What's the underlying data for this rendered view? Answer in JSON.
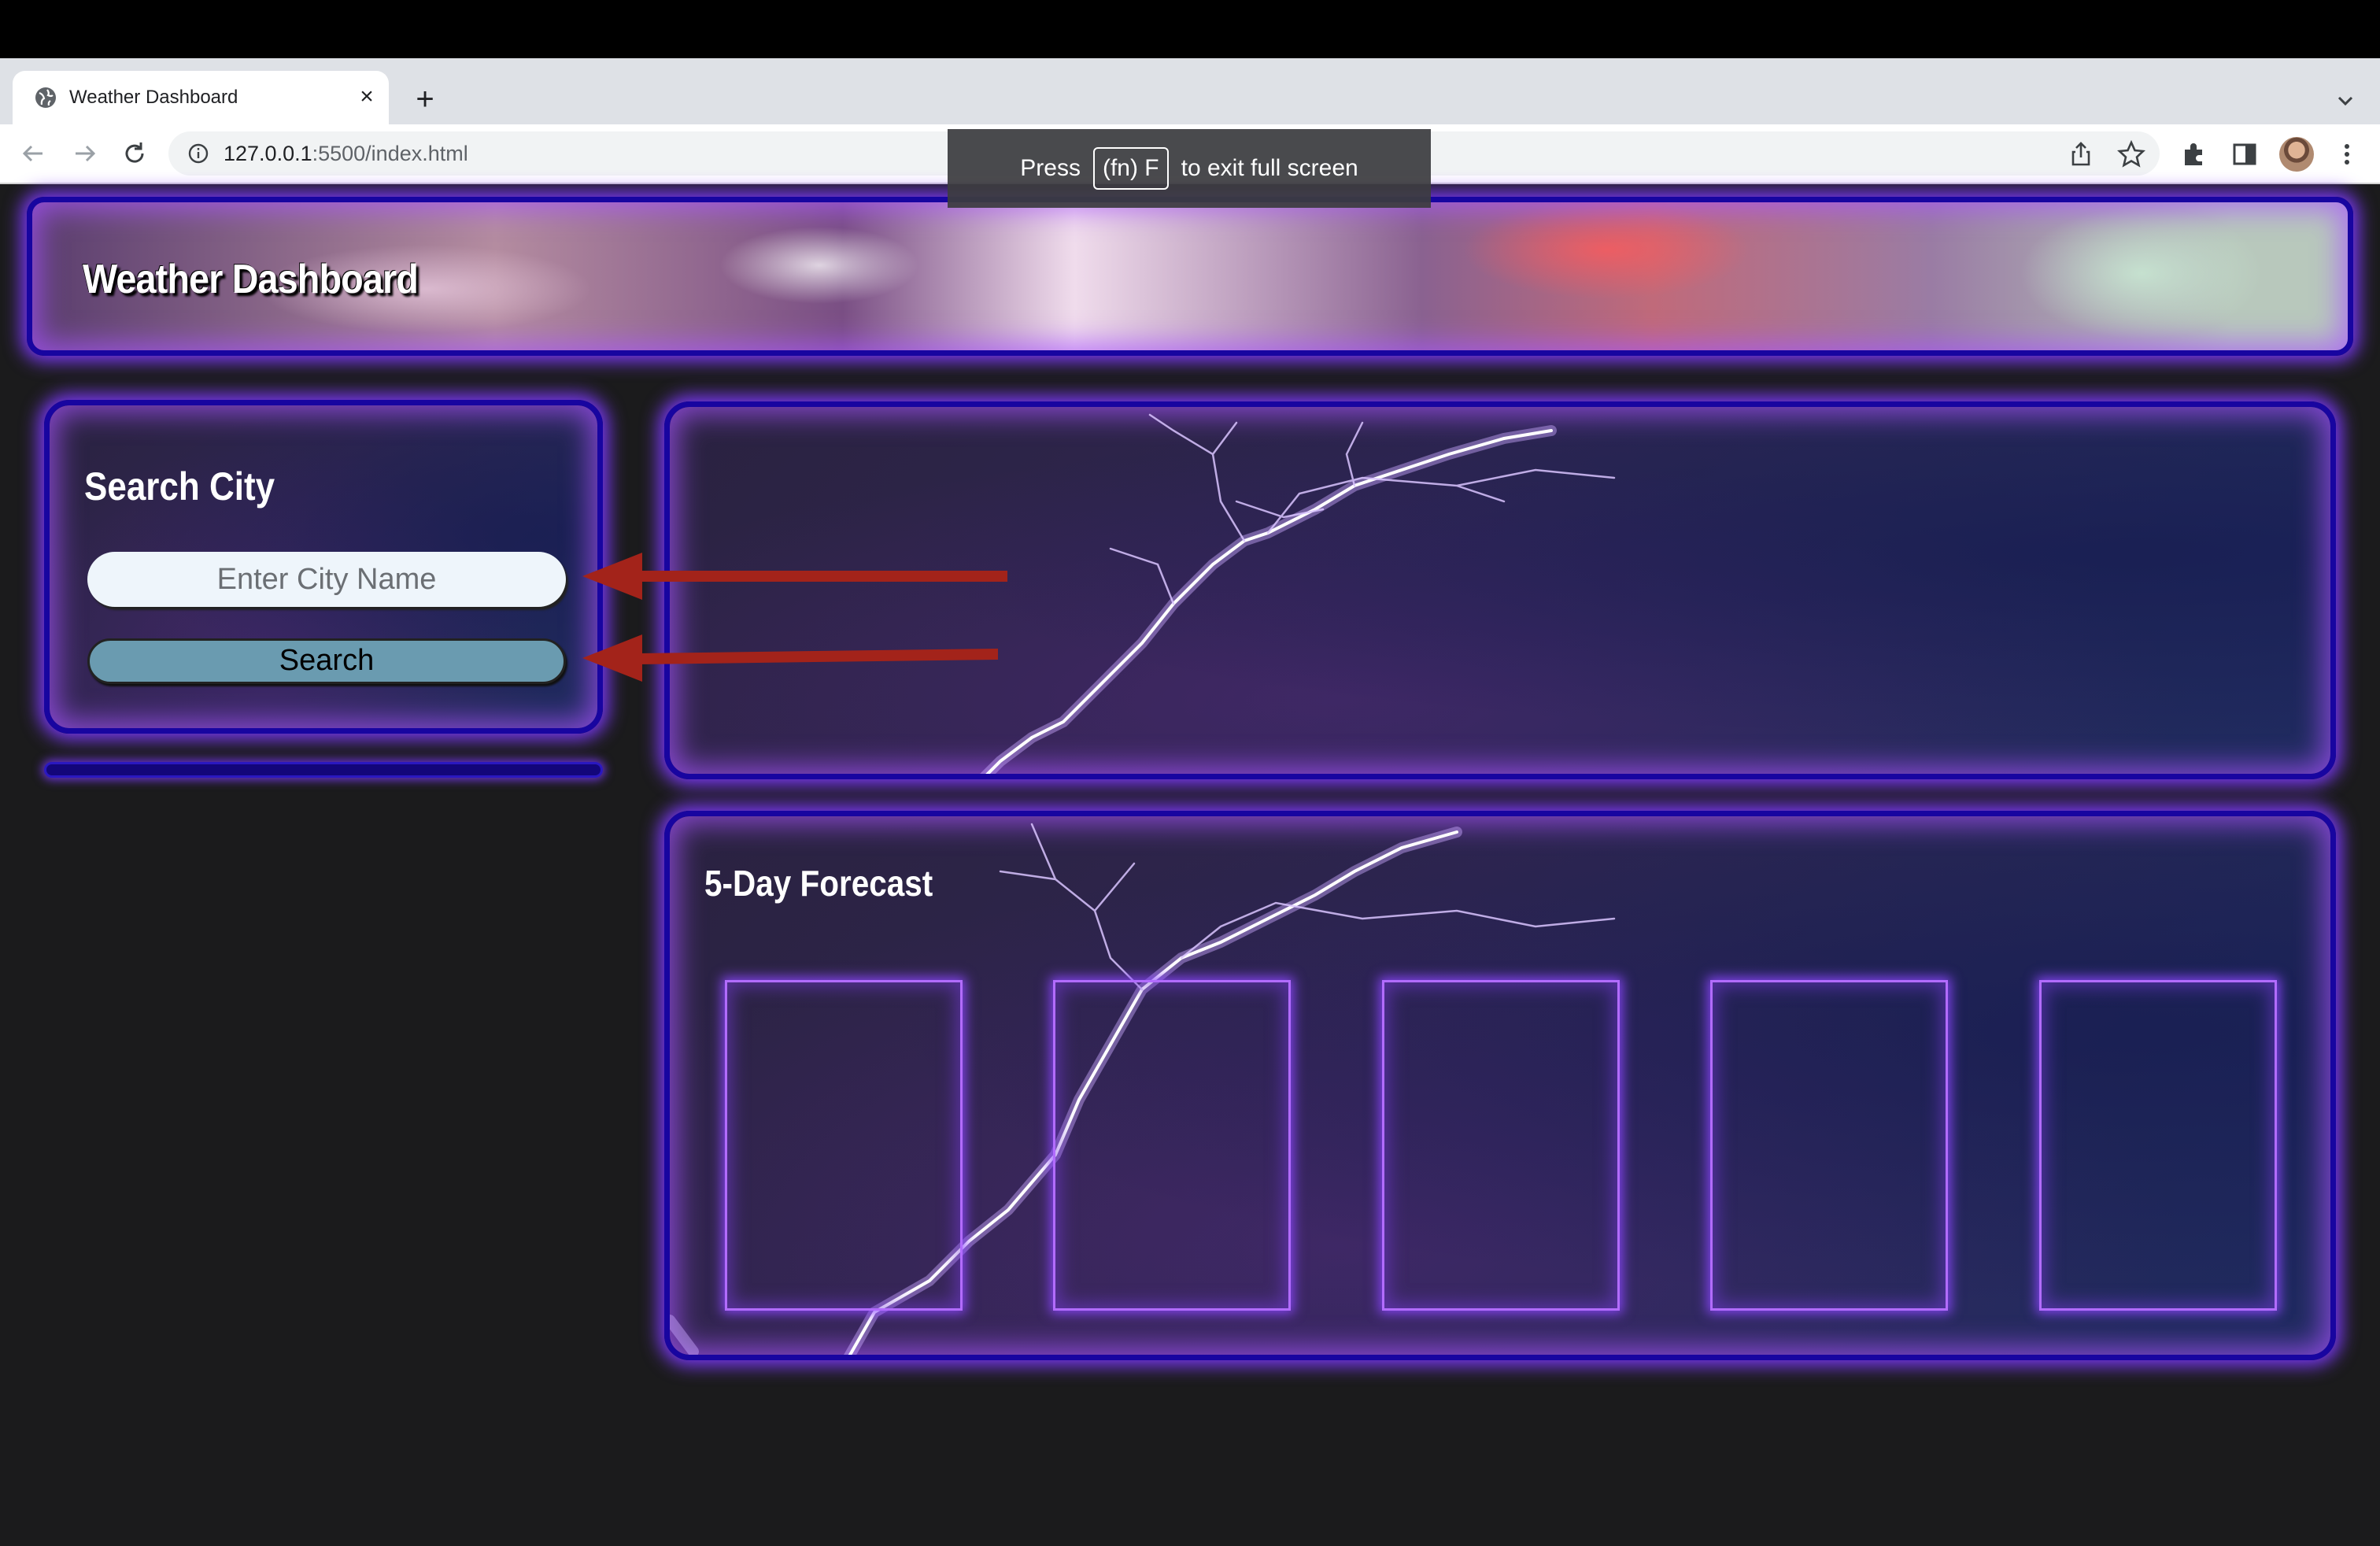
{
  "browser": {
    "tab_title": "Weather Dashboard",
    "url_host": "127.0.0.1",
    "url_rest": ":5500/index.html",
    "fullscreen_toast": {
      "prefix": "Press",
      "key": "(fn) F",
      "suffix": "to exit full screen"
    }
  },
  "page": {
    "header_title": "Weather Dashboard",
    "search": {
      "title": "Search City",
      "input_placeholder": "Enter City Name",
      "input_value": "",
      "button_label": "Search"
    },
    "forecast": {
      "title": "5-Day Forecast",
      "cards": [
        "",
        "",
        "",
        "",
        ""
      ]
    }
  },
  "colors": {
    "panel_border": "#1805a0",
    "glow": "#7e3aff",
    "button": "#6a9bb0",
    "annotation_arrow": "#a3231a"
  },
  "icons": [
    "globe-icon",
    "close-icon",
    "plus-icon",
    "back-icon",
    "forward-icon",
    "reload-icon",
    "info-icon",
    "share-icon",
    "star-icon",
    "extensions-icon",
    "side-panel-icon",
    "menu-icon",
    "chevron-down-icon"
  ]
}
